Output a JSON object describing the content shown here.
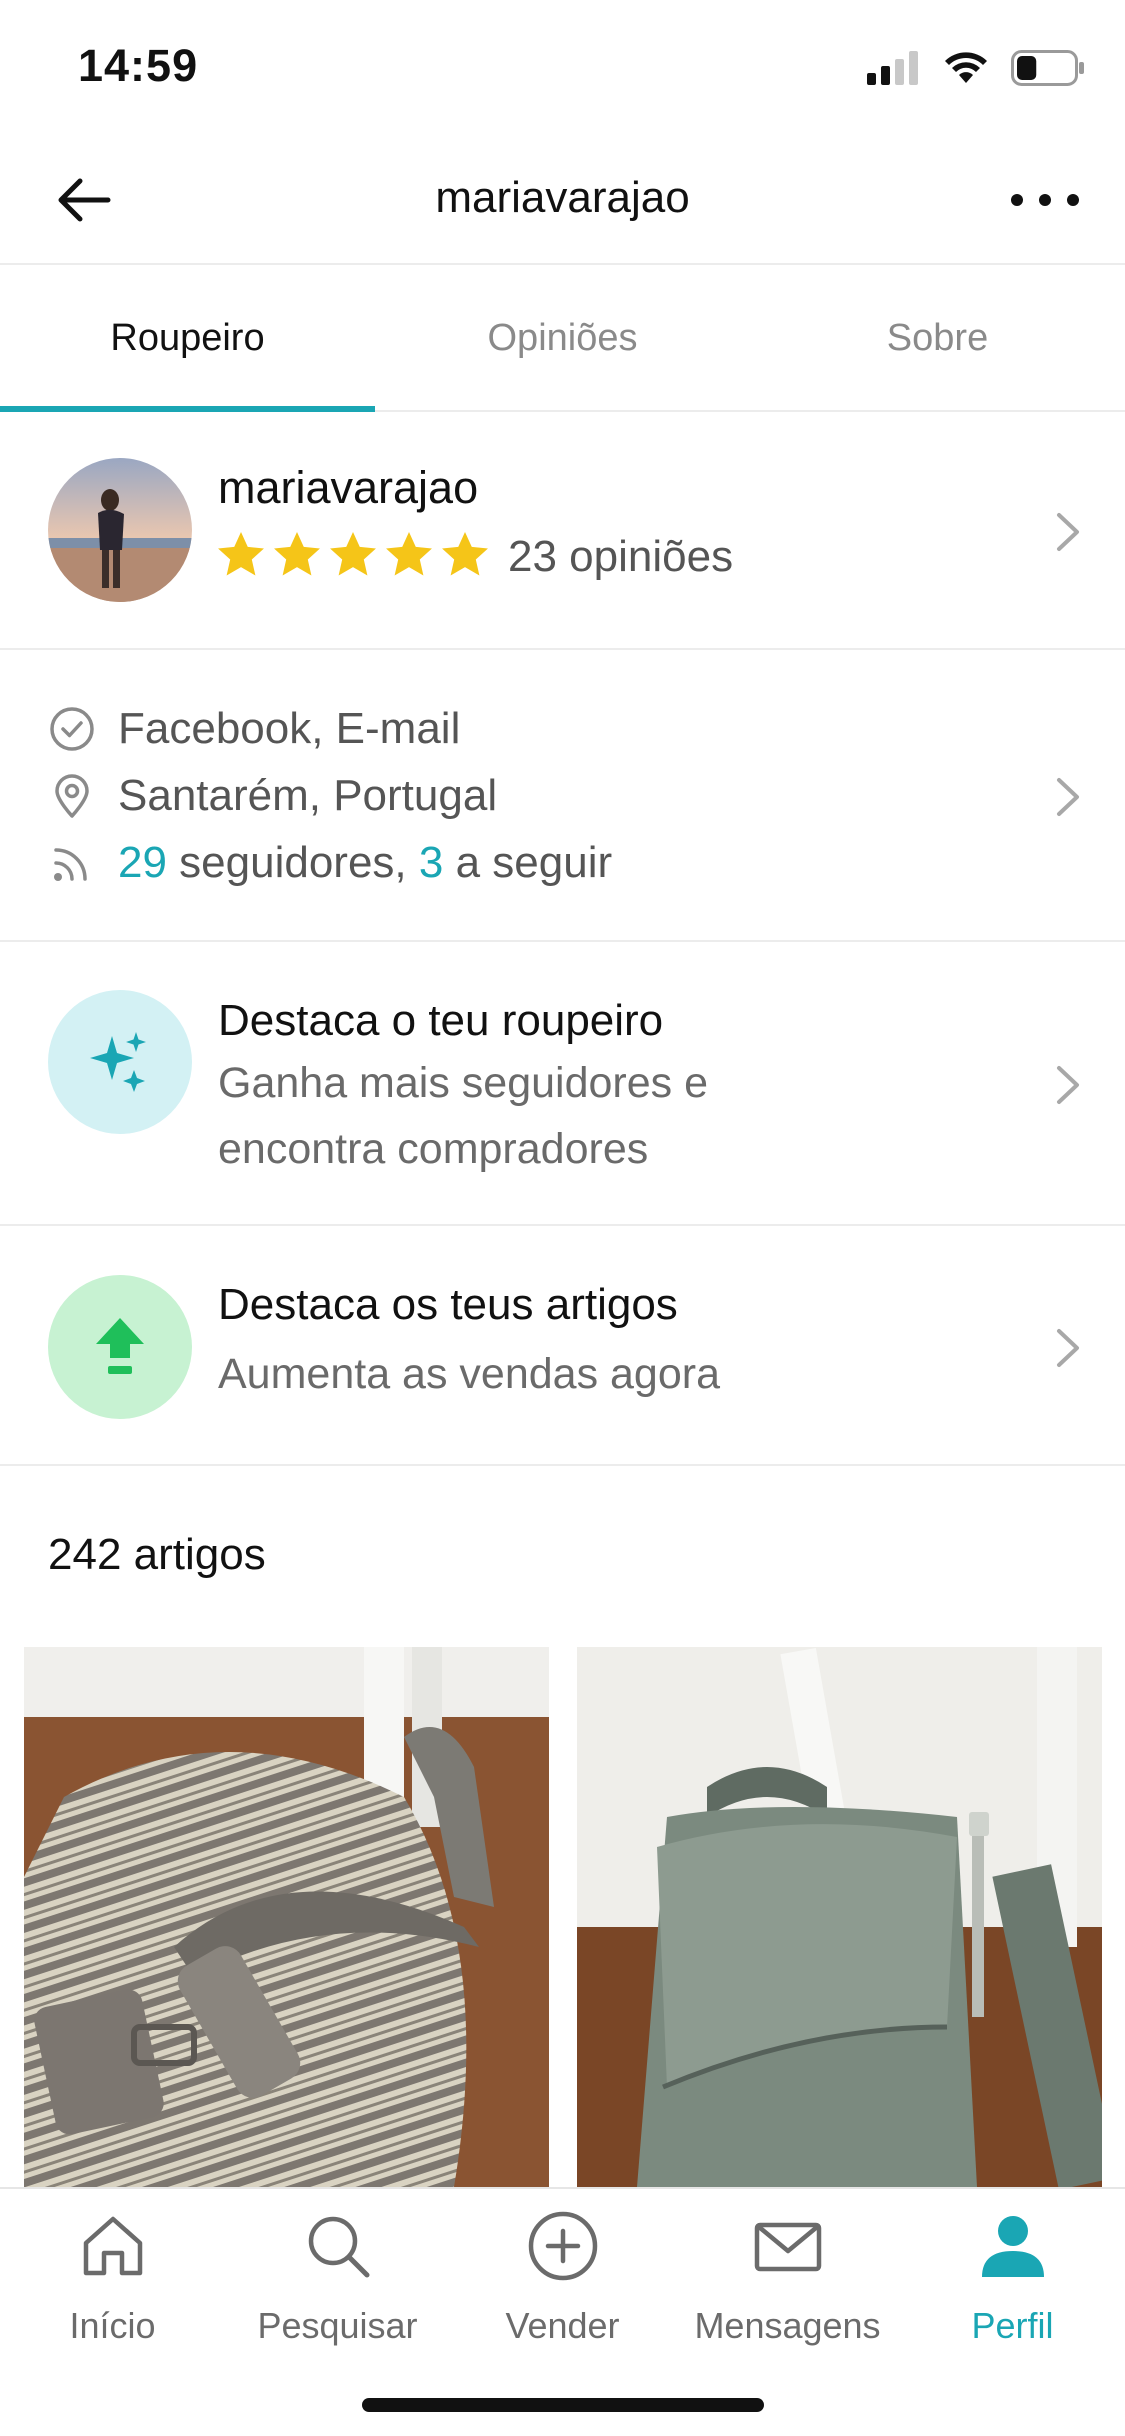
{
  "status_bar": {
    "time": "14:59",
    "icons": [
      "signal-icon",
      "wifi-icon",
      "battery-icon"
    ],
    "battery_level": 0.35
  },
  "header": {
    "title": "mariavarajao",
    "back_icon": "arrow-left-icon",
    "more_icon": "more-horizontal-icon"
  },
  "tabs": [
    {
      "label": "Roupeiro",
      "active": true
    },
    {
      "label": "Opiniões",
      "active": false
    },
    {
      "label": "Sobre",
      "active": false
    }
  ],
  "profile": {
    "username": "mariavarajao",
    "rating": 5,
    "rating_max": 5,
    "reviews_label": "23 opiniões"
  },
  "info": {
    "verified": "Facebook, E-mail",
    "location": "Santarém, Portugal",
    "followers_count": "29",
    "followers_label": " seguidores, ",
    "following_count": "3",
    "following_label": " a seguir"
  },
  "promos": [
    {
      "title": "Destaca o teu roupeiro",
      "subtitle_line1": "Ganha mais seguidores e",
      "subtitle_line2": "encontra compradores",
      "icon": "sparkles-icon"
    },
    {
      "title": "Destaca os teus artigos",
      "subtitle_line1": "Aumenta as vendas agora",
      "icon": "upload-arrow-icon"
    }
  ],
  "items": {
    "count_label": "242 artigos"
  },
  "bottom_nav": [
    {
      "label": "Início",
      "icon": "home-icon",
      "active": false
    },
    {
      "label": "Pesquisar",
      "icon": "search-icon",
      "active": false
    },
    {
      "label": "Vender",
      "icon": "plus-circle-icon",
      "active": false
    },
    {
      "label": "Mensagens",
      "icon": "mail-icon",
      "active": false
    },
    {
      "label": "Perfil",
      "icon": "person-icon",
      "active": true
    }
  ],
  "colors": {
    "accent": "#1aa6b4",
    "star": "#f5c518",
    "promo1_bg": "#d3f1f4",
    "promo2_bg": "#c7f2d2",
    "promo2_icon": "#1fbf5a"
  }
}
